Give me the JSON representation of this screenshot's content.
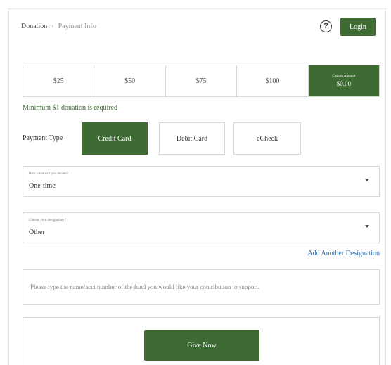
{
  "breadcrumb": {
    "step1": "Donation",
    "separator": "›",
    "step2": "Payment Info"
  },
  "header": {
    "help_icon": "?",
    "login_label": "Login"
  },
  "amounts": {
    "options": [
      "$25",
      "$50",
      "$75",
      "$100"
    ],
    "custom_label": "Custom Amount",
    "custom_value": "$0.00"
  },
  "minimum_note": "Minimum $1 donation is required",
  "payment_type": {
    "label": "Payment Type",
    "options": [
      "Credit Card",
      "Debit Card",
      "eCheck"
    ],
    "selected": "Credit Card"
  },
  "frequency": {
    "label": "How often will you donate?",
    "value": "One-time"
  },
  "designation": {
    "label": "Choose your designation *",
    "value": "Other"
  },
  "add_designation_link": "Add Another Designation",
  "fund_field": {
    "placeholder": "Please type the name/acct number of the fund you would like your contribution to support."
  },
  "give_button": "Give Now",
  "colors": {
    "accent": "#3e6b34",
    "link": "#2d6ea8",
    "border": "#d6d6d6"
  }
}
